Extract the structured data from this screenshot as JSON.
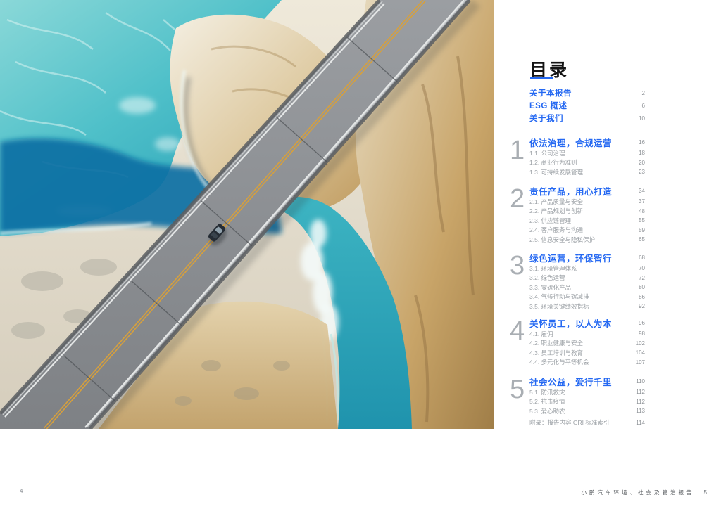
{
  "photo": {
    "alt": "aerial-highway-bridge-over-turquoise-canyon-river"
  },
  "toc": {
    "title": "目录",
    "front_items": [
      {
        "label": "关于本报告",
        "page": "2"
      },
      {
        "label": "ESG 概述",
        "page": "6"
      },
      {
        "label": "关于我们",
        "page": "10"
      }
    ],
    "sections": [
      {
        "number": "1",
        "title": "依法治理，合规运营",
        "page": "16",
        "subs": [
          {
            "label": "1.1. 公司治理",
            "page": "18"
          },
          {
            "label": "1.2. 商业行为准则",
            "page": "20"
          },
          {
            "label": "1.3. 可持续发展管理",
            "page": "23"
          }
        ]
      },
      {
        "number": "2",
        "title": "责任产品，用心打造",
        "page": "34",
        "subs": [
          {
            "label": "2.1. 产品质量与安全",
            "page": "37"
          },
          {
            "label": "2.2. 产品规划与创新",
            "page": "48"
          },
          {
            "label": "2.3. 供应链管理",
            "page": "55"
          },
          {
            "label": "2.4. 客户服务与沟通",
            "page": "59"
          },
          {
            "label": "2.5. 信息安全与隐私保护",
            "page": "65"
          }
        ]
      },
      {
        "number": "3",
        "title": "绿色运营，环保智行",
        "page": "68",
        "subs": [
          {
            "label": "3.1. 环境管理体系",
            "page": "70"
          },
          {
            "label": "3.2. 绿色运营",
            "page": "72"
          },
          {
            "label": "3.3. 零碳化产品",
            "page": "80"
          },
          {
            "label": "3.4. 气候行动与碳减排",
            "page": "86"
          },
          {
            "label": "3.5. 环境关键绩效指标",
            "page": "92"
          }
        ]
      },
      {
        "number": "4",
        "title": "关怀员工，以人为本",
        "page": "96",
        "subs": [
          {
            "label": "4.1. 雇佣",
            "page": "98"
          },
          {
            "label": "4.2. 职业健康与安全",
            "page": "102"
          },
          {
            "label": "4.3. 员工培训与教育",
            "page": "104"
          },
          {
            "label": "4.4. 多元化与平等机会",
            "page": "107"
          }
        ]
      },
      {
        "number": "5",
        "title": "社会公益，爱行千里",
        "page": "110",
        "subs": [
          {
            "label": "5.1. 防汛救灾",
            "page": "112"
          },
          {
            "label": "5.2. 抗击疫情",
            "page": "112"
          },
          {
            "label": "5.3. 爱心助农",
            "page": "113"
          }
        ]
      }
    ],
    "appendix": {
      "label": "附录：报告内容 GRI 标准索引",
      "page": "114"
    }
  },
  "footer": {
    "left_page": "4",
    "right_text": "小鹏汽车环境、社会及管治报告",
    "right_page": "5"
  },
  "colors": {
    "accent_blue": "#2468F2",
    "sub_gray": "#9ba0a5",
    "numeral_gray": "#a9aeb3"
  }
}
